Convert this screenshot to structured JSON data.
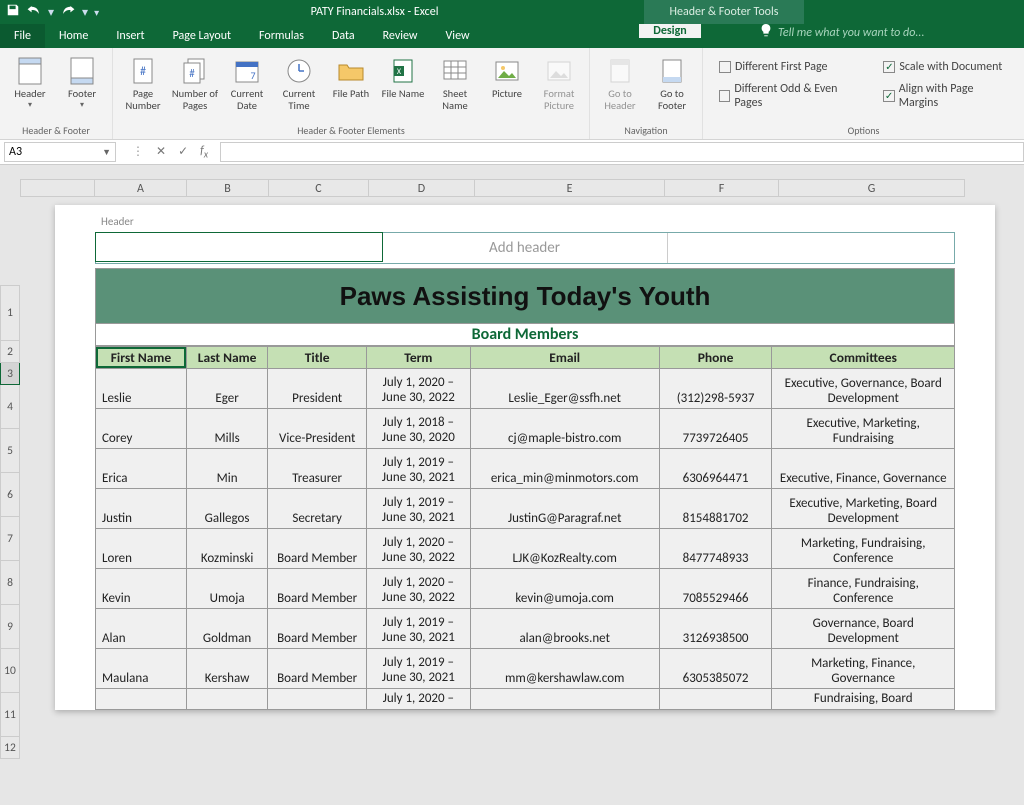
{
  "app": {
    "title": "PATY Financials.xlsx - Excel",
    "context_tool": "Header & Footer Tools"
  },
  "tabs": {
    "file": "File",
    "home": "Home",
    "insert": "Insert",
    "pagelayout": "Page Layout",
    "formulas": "Formulas",
    "data": "Data",
    "review": "Review",
    "view": "View",
    "design": "Design",
    "tellme": "Tell me what you want to do..."
  },
  "ribbon": {
    "hf_group": "Header & Footer",
    "header": "Header",
    "footer": "Footer",
    "elements_group": "Header & Footer Elements",
    "page_number": "Page Number",
    "num_pages": "Number of Pages",
    "cur_date": "Current Date",
    "cur_time": "Current Time",
    "file_path": "File Path",
    "file_name": "File Name",
    "sheet_name": "Sheet Name",
    "picture": "Picture",
    "format_picture": "Format Picture",
    "nav_group": "Navigation",
    "goto_header": "Go to Header",
    "goto_footer": "Go to Footer",
    "options_group": "Options",
    "diff_first": "Different First Page",
    "diff_odd": "Different Odd & Even Pages",
    "scale": "Scale with Document",
    "align_margins": "Align with Page Margins"
  },
  "namebox": "A3",
  "columns": [
    "A",
    "B",
    "C",
    "D",
    "E",
    "F",
    "G"
  ],
  "rows": [
    "1",
    "2",
    "3",
    "4",
    "5",
    "6",
    "7",
    "8",
    "9",
    "10",
    "11",
    "12"
  ],
  "page": {
    "header_label": "Header",
    "add_header": "Add header",
    "banner": "Paws Assisting Today's Youth",
    "subtitle": "Board Members",
    "th": {
      "fn": "First Name",
      "ln": "Last Name",
      "title": "Title",
      "term": "Term",
      "email": "Email",
      "phone": "Phone",
      "comm": "Committees"
    },
    "rows": [
      {
        "fn": "Leslie",
        "ln": "Eger",
        "title": "President",
        "term": "July 1, 2020 – June 30, 2022",
        "email": "Leslie_Eger@ssfh.net",
        "phone": "(312)298-5937",
        "comm": "Executive, Governance, Board Development"
      },
      {
        "fn": "Corey",
        "ln": "Mills",
        "title": "Vice-President",
        "term": "July 1, 2018 – June 30, 2020",
        "email": "cj@maple-bistro.com",
        "phone": "7739726405",
        "comm": "Executive, Marketing, Fundraising"
      },
      {
        "fn": "Erica",
        "ln": "Min",
        "title": "Treasurer",
        "term": "July 1, 2019 – June 30, 2021",
        "email": "erica_min@minmotors.com",
        "phone": "6306964471",
        "comm": "Executive, Finance, Governance"
      },
      {
        "fn": "Justin",
        "ln": "Gallegos",
        "title": "Secretary",
        "term": "July 1, 2019 – June 30, 2021",
        "email": "JustinG@Paragraf.net",
        "phone": "8154881702",
        "comm": "Executive, Marketing, Board Development"
      },
      {
        "fn": "Loren",
        "ln": "Kozminski",
        "title": "Board Member",
        "term": "July 1, 2020 – June 30, 2022",
        "email": "LJK@KozRealty.com",
        "phone": "8477748933",
        "comm": "Marketing, Fundraising, Conference"
      },
      {
        "fn": "Kevin",
        "ln": "Umoja",
        "title": "Board Member",
        "term": "July 1, 2020 – June 30, 2022",
        "email": "kevin@umoja.com",
        "phone": "7085529466",
        "comm": "Finance, Fundraising, Conference"
      },
      {
        "fn": "Alan",
        "ln": "Goldman",
        "title": "Board Member",
        "term": "July 1, 2019 – June 30, 2021",
        "email": "alan@brooks.net",
        "phone": "3126938500",
        "comm": "Governance, Board Development"
      },
      {
        "fn": "Maulana",
        "ln": "Kershaw",
        "title": "Board Member",
        "term": "July 1, 2019 – June 30, 2021",
        "email": "mm@kershawlaw.com",
        "phone": "6305385072",
        "comm": "Marketing, Finance, Governance"
      },
      {
        "fn": "",
        "ln": "",
        "title": "",
        "term": "July 1, 2020 –",
        "email": "",
        "phone": "",
        "comm": "Fundraising, Board"
      }
    ]
  }
}
